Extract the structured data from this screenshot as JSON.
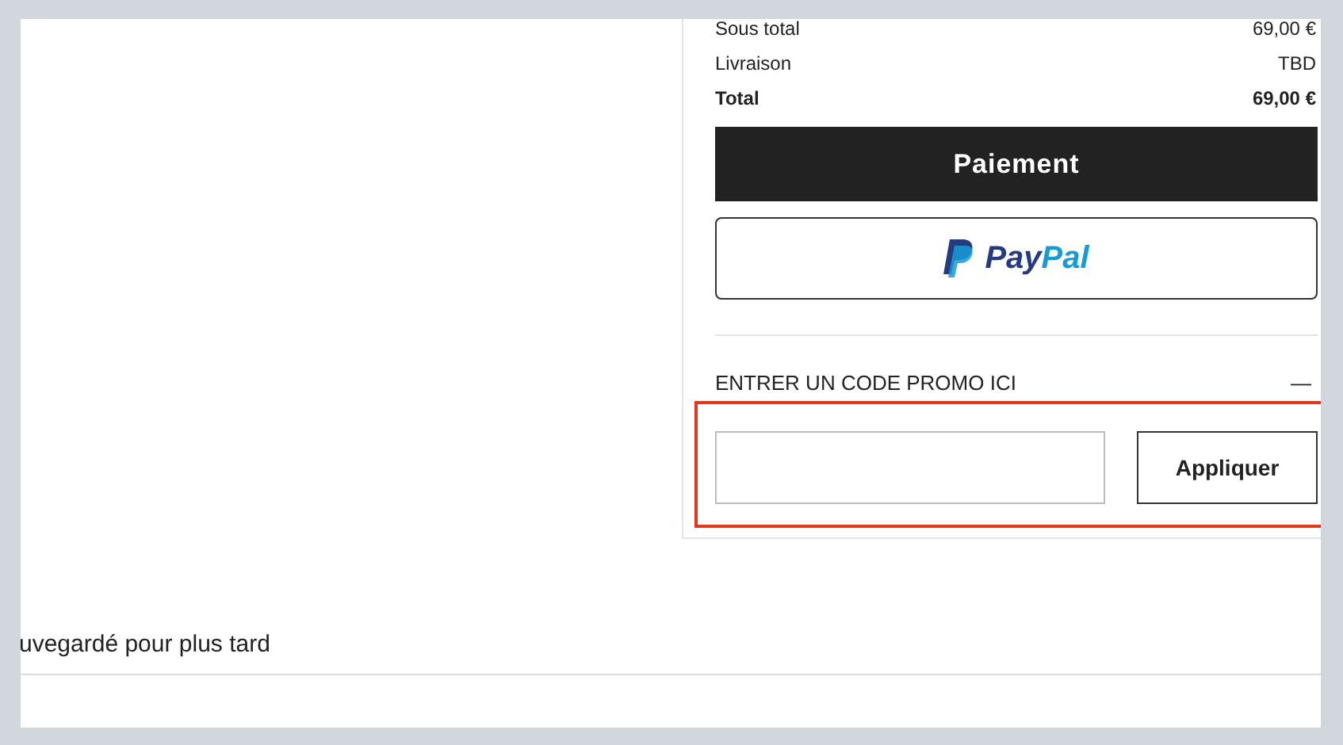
{
  "summary": {
    "rows": [
      {
        "label": "Sous total",
        "value": "69,00 €",
        "kind": "normal"
      },
      {
        "label": "Livraison",
        "value": "TBD",
        "kind": "normal"
      },
      {
        "label": "Total",
        "value": "69,00 €",
        "kind": "total"
      }
    ]
  },
  "checkout_button": "Paiement",
  "paypal_button": {
    "wordmark_dark": "Pay",
    "wordmark_light": "Pal"
  },
  "promo": {
    "heading": "ENTRER UN CODE PROMO ICI",
    "toggle": "—",
    "apply_button": "Appliquer"
  },
  "saved_heading": "uvegardé pour plus tard"
}
